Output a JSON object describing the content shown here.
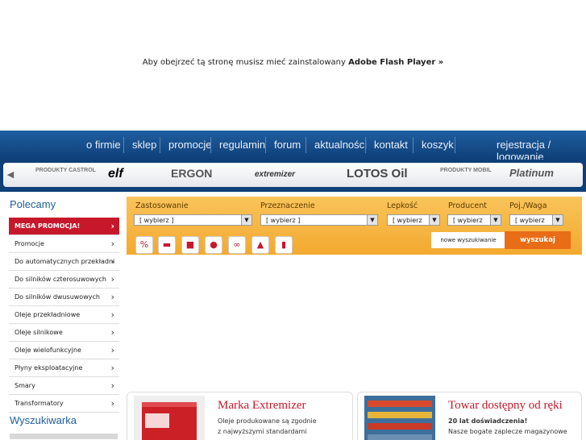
{
  "flash_notice": {
    "text": "Aby obejrzeć tą stronę musisz mieć zainstalowany ",
    "link": "Adobe Flash Player »"
  },
  "nav": {
    "items": [
      "o firmie",
      "sklep",
      "promocje",
      "regulamin",
      "forum",
      "aktualności",
      "kontakt",
      "koszyk"
    ],
    "account": "rejestracja / logowanie"
  },
  "brands": [
    "PRODUKTY CASTROL",
    "elf",
    "ERGON",
    "extremizer",
    "LOTOS Oil",
    "PRODUKTY MOBIL",
    "Platinum"
  ],
  "sidebar": {
    "title": "Polecamy",
    "items": [
      "MEGA PROMOCJA!",
      "Promocje",
      "Do automatycznych przekładni",
      "Do silników czterosuwowych",
      "Do silników dwusuwowych",
      "Oleje przekładniowe",
      "Oleje silnikowe",
      "Oleje wielofunkcyjne",
      "Płyny eksploatacyjne",
      "Smary",
      "Transformatory"
    ],
    "search_title": "Wyszukiwarka"
  },
  "filter": {
    "labels": [
      "Zastosowanie",
      "Przeznaczenie",
      "Lepkość",
      "Producent",
      "Poj./Waga"
    ],
    "selects": [
      "[ wybierz ]",
      "[ wybierz ]",
      "[ wybierz",
      "[ wybierz",
      "[ wybierz"
    ],
    "category_icons": [
      "promo-icon",
      "car-icon",
      "truck-icon",
      "tractor-icon",
      "motorcycle-icon",
      "construction-icon",
      "industry-icon"
    ],
    "new_search": "nowe wyszukiwanie",
    "search_button": "wyszukaj"
  },
  "promos": [
    {
      "title": "Marka Extremizer",
      "desc1": "Oleje produkowane są zgodnie",
      "desc2": "z najwyższymi standardami"
    },
    {
      "title": "Towar dostępny od ręki",
      "desc1": "20 lat doświadczenia!",
      "desc2": "Nasze bogate zaplecze magazynowe"
    }
  ],
  "colors": {
    "nav": "#1f5ea0",
    "accent": "#c7182b",
    "filter": "#f3a92f",
    "button": "#e96c16"
  }
}
